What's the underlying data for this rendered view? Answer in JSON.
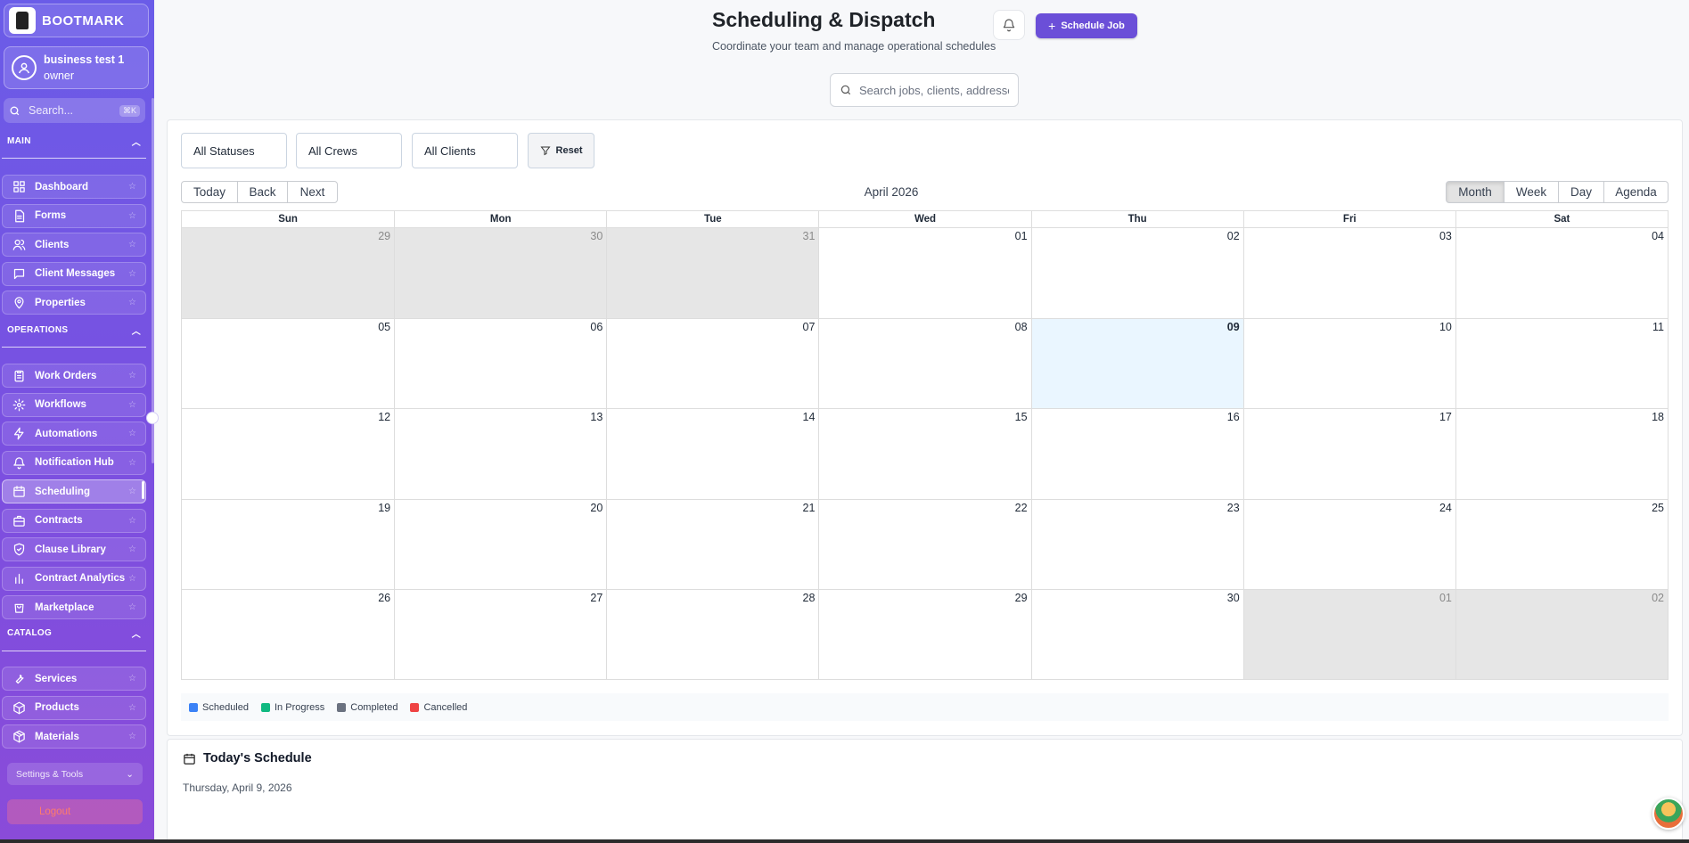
{
  "brand": {
    "name": "BOOTMARK"
  },
  "user": {
    "name": "business test 1",
    "role": "owner"
  },
  "sidebar_search": {
    "placeholder": "Search...",
    "shortcut": "⌘K"
  },
  "sections": {
    "main": "MAIN",
    "operations": "OPERATIONS",
    "catalog": "CATALOG"
  },
  "nav": {
    "main": [
      {
        "label": "Dashboard",
        "icon": "dashboard-icon"
      },
      {
        "label": "Forms",
        "icon": "document-icon"
      },
      {
        "label": "Clients",
        "icon": "users-icon"
      },
      {
        "label": "Client Messages",
        "icon": "message-icon"
      },
      {
        "label": "Properties",
        "icon": "location-pin-icon"
      }
    ],
    "operations": [
      {
        "label": "Work Orders",
        "icon": "clipboard-icon"
      },
      {
        "label": "Workflows",
        "icon": "gear-icon"
      },
      {
        "label": "Automations",
        "icon": "lightning-icon"
      },
      {
        "label": "Notification Hub",
        "icon": "bell-icon"
      },
      {
        "label": "Scheduling",
        "icon": "calendar-icon",
        "active": true
      },
      {
        "label": "Contracts",
        "icon": "briefcase-icon"
      },
      {
        "label": "Clause Library",
        "icon": "shield-icon"
      },
      {
        "label": "Contract Analytics",
        "icon": "bar-chart-icon"
      },
      {
        "label": "Marketplace",
        "icon": "shopping-bag-icon"
      }
    ],
    "catalog": [
      {
        "label": "Services",
        "icon": "wrench-icon"
      },
      {
        "label": "Products",
        "icon": "box-icon"
      },
      {
        "label": "Materials",
        "icon": "package-icon"
      }
    ]
  },
  "settings_label": "Settings & Tools",
  "logout_label": "Logout",
  "header": {
    "title": "Scheduling & Dispatch",
    "subtitle": "Coordinate your team and manage operational schedules",
    "schedule_button": "Schedule Job"
  },
  "search": {
    "placeholder": "Search jobs, clients, addresses..."
  },
  "filters": {
    "status": "All Statuses",
    "crews": "All Crews",
    "clients": "All Clients",
    "reset": "Reset"
  },
  "toolbar": {
    "nav": [
      "Today",
      "Back",
      "Next"
    ],
    "label": "April 2026",
    "views": [
      "Month",
      "Week",
      "Day",
      "Agenda"
    ],
    "active_view": "Month"
  },
  "calendar": {
    "weekdays": [
      "Sun",
      "Mon",
      "Tue",
      "Wed",
      "Thu",
      "Fri",
      "Sat"
    ],
    "weeks": [
      [
        {
          "d": "29",
          "off": true
        },
        {
          "d": "30",
          "off": true
        },
        {
          "d": "31",
          "off": true
        },
        {
          "d": "01"
        },
        {
          "d": "02"
        },
        {
          "d": "03"
        },
        {
          "d": "04"
        }
      ],
      [
        {
          "d": "05"
        },
        {
          "d": "06"
        },
        {
          "d": "07"
        },
        {
          "d": "08"
        },
        {
          "d": "09",
          "today": true
        },
        {
          "d": "10"
        },
        {
          "d": "11"
        }
      ],
      [
        {
          "d": "12"
        },
        {
          "d": "13"
        },
        {
          "d": "14"
        },
        {
          "d": "15"
        },
        {
          "d": "16"
        },
        {
          "d": "17"
        },
        {
          "d": "18"
        }
      ],
      [
        {
          "d": "19"
        },
        {
          "d": "20"
        },
        {
          "d": "21"
        },
        {
          "d": "22"
        },
        {
          "d": "23"
        },
        {
          "d": "24"
        },
        {
          "d": "25"
        }
      ],
      [
        {
          "d": "26"
        },
        {
          "d": "27"
        },
        {
          "d": "28"
        },
        {
          "d": "29"
        },
        {
          "d": "30"
        },
        {
          "d": "01",
          "off": true
        },
        {
          "d": "02",
          "off": true
        }
      ]
    ]
  },
  "legend": [
    {
      "label": "Scheduled",
      "color": "#3b82f6"
    },
    {
      "label": "In Progress",
      "color": "#10b981"
    },
    {
      "label": "Completed",
      "color": "#6b7280"
    },
    {
      "label": "Cancelled",
      "color": "#ef4444"
    }
  ],
  "today_schedule": {
    "title": "Today's Schedule",
    "date": "Thursday, April 9, 2026"
  }
}
